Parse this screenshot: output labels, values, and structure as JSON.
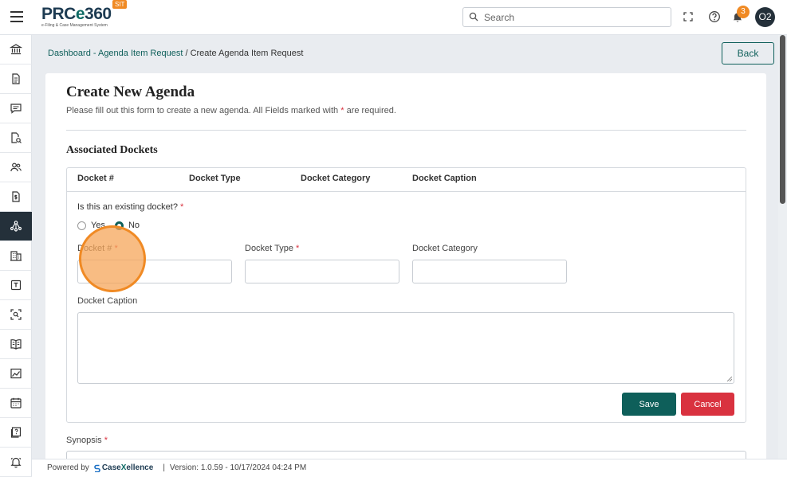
{
  "header": {
    "logo_text_a": "PRC",
    "logo_text_b": "e",
    "logo_text_c": "360",
    "logo_sub": "e-Filing & Case Management System",
    "env_badge": "SIT",
    "search_placeholder": "Search",
    "notification_count": "3",
    "avatar_initials": "O2"
  },
  "breadcrumb": {
    "link": "Dashboard - Agenda Item Request",
    "separator": " / ",
    "current": "Create Agenda Item Request"
  },
  "back_label": "Back",
  "form": {
    "title": "Create New Agenda",
    "subtitle_a": "Please fill out this form to create a new agenda. All Fields marked with ",
    "required_mark": "*",
    "subtitle_b": " are required.",
    "section_title": "Associated Dockets",
    "table_headers": [
      "Docket #",
      "Docket Type",
      "Docket Category",
      "Docket Caption"
    ],
    "question": "Is this an existing docket?",
    "radio_yes": "Yes",
    "radio_no": "No",
    "radio_selected": "No",
    "field_docket_number": "Docket #",
    "field_docket_type": "Docket Type",
    "field_docket_category": "Docket Category",
    "field_docket_caption": "Docket Caption",
    "save_label": "Save",
    "cancel_label": "Cancel",
    "synopsis_label": "Synopsis"
  },
  "footer": {
    "powered_by": "Powered by",
    "brand_a": "Case",
    "brand_b": "X",
    "brand_c": "ellence",
    "divider": "|",
    "version": "Version: 1.0.59 - 10/17/2024 04:24 PM"
  },
  "colors": {
    "accent": "#0e5f5a",
    "danger": "#d9323f",
    "sidebar_active": "#24303a",
    "badge": "#f08a24"
  },
  "sidebar_icons": [
    "bank-icon",
    "document-icon",
    "chat-icon",
    "document-search-icon",
    "users-icon",
    "dollar-document-icon",
    "network-icon",
    "building-icon",
    "template-icon",
    "scan-search-icon",
    "book-icon",
    "chart-icon",
    "calendar-icon",
    "help-book-icon",
    "bell-icon"
  ]
}
